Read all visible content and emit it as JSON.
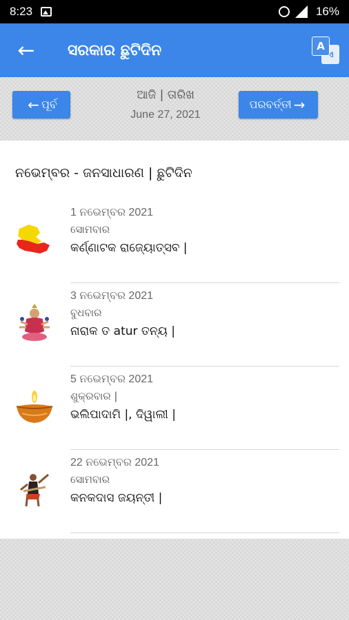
{
  "status_bar": {
    "time": "8:23",
    "battery": "16%"
  },
  "app_bar": {
    "title": "ସରକାର ଛୁଟିଦିନ",
    "back_icon": "←",
    "translate_a": "A",
    "translate_b": "ଏ"
  },
  "nav": {
    "prev_label": "ପୂର୍ବ",
    "next_label": "ପରବର୍ତ୍ତୀ",
    "today_label": "ଆଜି | ତାରିଖ",
    "today_date": "June 27, 2021"
  },
  "section_title": "ନଭେମ୍ବର - ଜନସାଧାରଣ | ଛୁଟିଦିନ",
  "holidays": [
    {
      "date": "1 ନଭେମ୍ବର 2021",
      "day": "ସୋମବାର",
      "name": "କର୍ଣ୍ଣାଟକ ରାଜ୍ୟୋତ୍ସବ |",
      "icon": "karnataka-flag-icon"
    },
    {
      "date": "3 ନଭେମ୍ବର 2021",
      "day": "ବୁଧବାର",
      "name": "ନାରାକ ତ atur ତନ୍ୟ |",
      "icon": "goddess-icon"
    },
    {
      "date": "5 ନଭେମ୍ବର 2021",
      "day": "ଶୁକ୍ରବାର |",
      "name": "ଭଲିପାଦାମି |, ଦିୱାଲୀ |",
      "icon": "diya-lamp-icon"
    },
    {
      "date": "22 ନଭେମ୍ବର 2021",
      "day": "ସୋମବାର",
      "name": "କନକଦାସ ଜୟନ୍ତୀ |",
      "icon": "kanakadasa-icon"
    }
  ],
  "colors": {
    "accent": "#3b86e8",
    "status_bar": "#000000"
  }
}
